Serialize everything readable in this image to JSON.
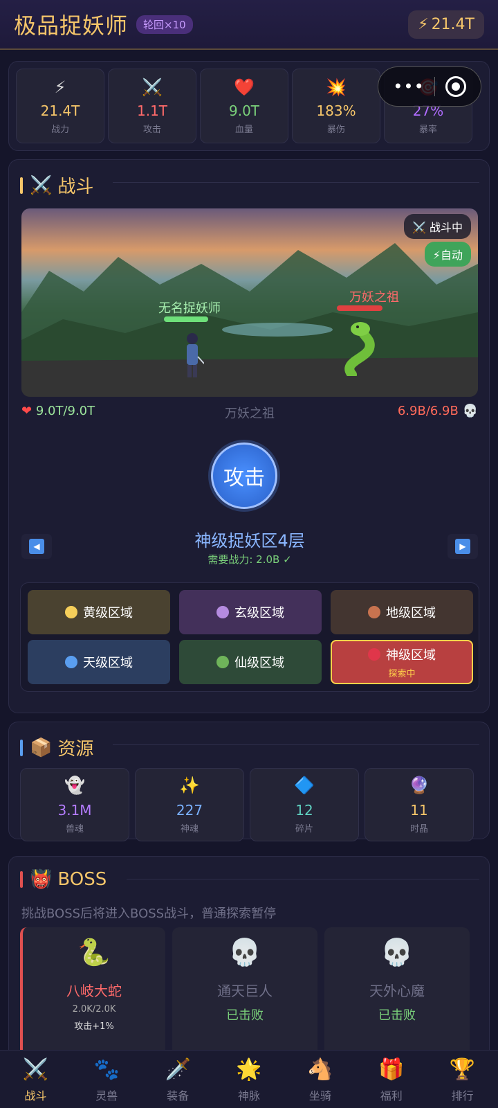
{
  "header": {
    "title": "极品捉妖师",
    "rebirth": "轮回×10",
    "power": "21.4T"
  },
  "stats": [
    {
      "icon": "⚡",
      "icon_name": "lightning-icon",
      "value": "21.4T",
      "label": "战力",
      "color": "#f6c66a"
    },
    {
      "icon": "⚔️",
      "icon_name": "crossed-swords-icon",
      "value": "1.1T",
      "label": "攻击",
      "color": "#ff6a6a"
    },
    {
      "icon": "❤️",
      "icon_name": "heart-icon",
      "value": "9.0T",
      "label": "血量",
      "color": "#7ad07a"
    },
    {
      "icon": "💥",
      "icon_name": "explosion-icon",
      "value": "183%",
      "label": "暴伤",
      "color": "#f6c66a"
    },
    {
      "icon": "🎯",
      "icon_name": "target-icon",
      "value": "27%",
      "label": "暴率",
      "color": "#b06cff"
    }
  ],
  "battle": {
    "section_icon": "⚔️",
    "section_title": "战斗",
    "status_badge": "⚔️ 战斗中",
    "auto_badge": "⚡自动",
    "hero_name": "无名捉妖师",
    "enemy_name": "万妖之祖",
    "hero_hp": "9.0T/9.0T",
    "enemy_label": "万妖之祖",
    "enemy_hp": "6.9B/6.9B",
    "attack_label": "攻击",
    "floor_name": "神级捉妖区4层",
    "floor_req": "需要战力: 2.0B ✓",
    "zones": [
      {
        "label": "黄级区域",
        "dot": "#f6cf5a",
        "bg": "#4a4230"
      },
      {
        "label": "玄级区域",
        "dot": "#b58be0",
        "bg": "#43305a"
      },
      {
        "label": "地级区域",
        "dot": "#c8734f",
        "bg": "#433530"
      },
      {
        "label": "天级区域",
        "dot": "#5a9ef0",
        "bg": "#2c3e60"
      },
      {
        "label": "仙级区域",
        "dot": "#6fb45a",
        "bg": "#2e4a38"
      },
      {
        "label": "神级区域",
        "dot": "#e0364a",
        "bg": "#b84040",
        "sub": "探索中",
        "active": true
      }
    ]
  },
  "resources": {
    "section_icon": "📦",
    "section_title": "资源",
    "items": [
      {
        "icon": "👻",
        "icon_name": "ghost-icon",
        "value": "3.1M",
        "label": "兽魂",
        "color": "#b47cff"
      },
      {
        "icon": "✨",
        "icon_name": "sparkles-icon",
        "value": "227",
        "label": "神魂",
        "color": "#7ab0ff"
      },
      {
        "icon": "🔷",
        "icon_name": "diamond-icon",
        "value": "12",
        "label": "碎片",
        "color": "#5fd0c0"
      },
      {
        "icon": "🔮",
        "icon_name": "crystal-ball-icon",
        "value": "11",
        "label": "时晶",
        "color": "#f6c66a"
      }
    ]
  },
  "boss": {
    "section_icon": "👹",
    "section_title": "BOSS",
    "tip": "挑战BOSS后将进入BOSS战斗，普通探索暂停",
    "cards": [
      {
        "icon": "🐍",
        "icon_name": "snake-icon",
        "name": "八岐大蛇",
        "hp": "2.0K/2.0K",
        "buff": "攻击+1%"
      },
      {
        "icon": "💀",
        "icon_name": "skull-icon",
        "name": "通天巨人",
        "status": "已击败"
      },
      {
        "icon": "💀",
        "icon_name": "skull-icon",
        "name": "天外心魔",
        "status": "已击败"
      }
    ]
  },
  "nav": [
    {
      "icon": "⚔️",
      "icon_name": "crossed-swords-icon",
      "label": "战斗",
      "active": true
    },
    {
      "icon": "🐾",
      "icon_name": "paw-icon",
      "label": "灵兽"
    },
    {
      "icon": "🗡️",
      "icon_name": "dagger-icon",
      "label": "装备"
    },
    {
      "icon": "🌟",
      "icon_name": "star-icon",
      "label": "神脉"
    },
    {
      "icon": "🐴",
      "icon_name": "horse-icon",
      "label": "坐骑"
    },
    {
      "icon": "🎁",
      "icon_name": "gift-icon",
      "label": "福利"
    },
    {
      "icon": "🏆",
      "icon_name": "trophy-icon",
      "label": "排行"
    }
  ]
}
